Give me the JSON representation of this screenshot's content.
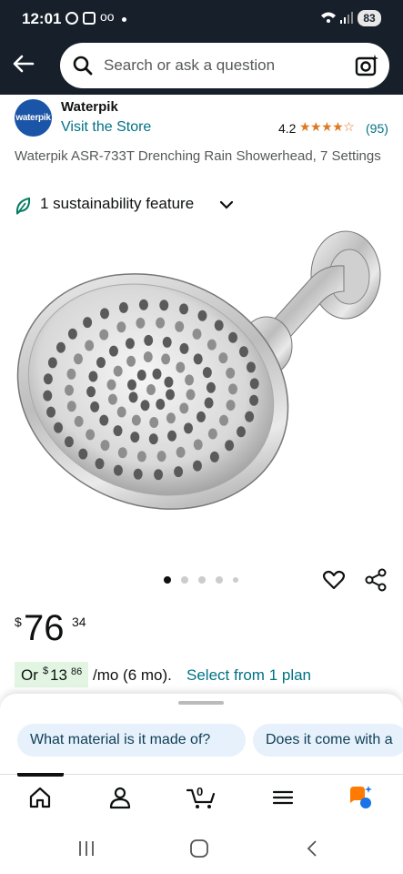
{
  "status_bar": {
    "time": "12:01",
    "battery": "83"
  },
  "search": {
    "placeholder": "Search or ask a question"
  },
  "brand": {
    "logo_text": "waterpik",
    "name": "Waterpik",
    "visit_store": "Visit the Store"
  },
  "rating": {
    "value": "4.2",
    "stars": 4.2,
    "count": "(95)"
  },
  "product": {
    "title": "Waterpik ASR-733T Drenching Rain Showerhead, 7 Settings",
    "sustainability": "1 sustainability feature"
  },
  "carousel": {
    "pages": 5,
    "current": 1
  },
  "price": {
    "currency": "$",
    "whole": "76",
    "fraction": "34"
  },
  "installment": {
    "prefix": "Or",
    "currency": "$",
    "whole": "13",
    "fraction": "86",
    "term": "/mo (6 mo).",
    "link": "Select from 1 plan"
  },
  "questions": [
    {
      "text": "What material is it made of?"
    },
    {
      "text": "Does it come with a"
    }
  ],
  "nav": {
    "tabs": [
      {
        "name": "home",
        "icon": "home-icon",
        "active": true
      },
      {
        "name": "account",
        "icon": "user-icon"
      },
      {
        "name": "cart",
        "icon": "cart-icon",
        "count": "0"
      },
      {
        "name": "menu",
        "icon": "menu-icon"
      },
      {
        "name": "rufus",
        "icon": "rufus-icon"
      }
    ]
  },
  "colors": {
    "header": "#17202a",
    "link": "#007185",
    "star": "#de7921",
    "chip": "#e6f1fb",
    "installment_bg": "#e2f5e3"
  }
}
